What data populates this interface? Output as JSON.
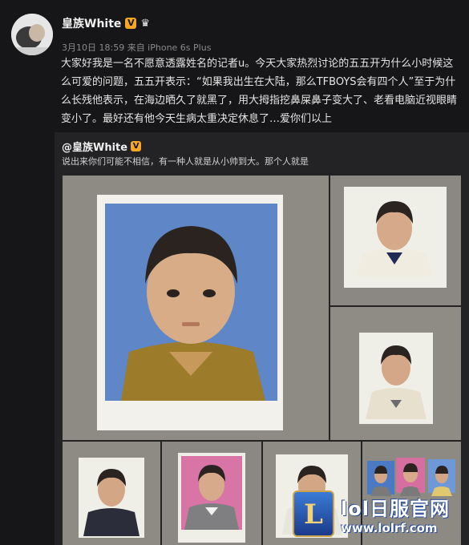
{
  "post": {
    "username": "皇族White",
    "verified_badge": "V",
    "crown_icon": "crown-icon",
    "meta": "3月10日 18:59 来自 iPhone 6s Plus",
    "text": "大家好我是一名不愿意透露姓名的记者u。今天大家热烈讨论的五五开为什么小时候这么可爱的问题，五五开表示：“如果我出生在大陆，那么TFBOYS会有四个人”至于为什么长残他表示，在海边晒久了就黑了，用大拇指挖鼻屎鼻子变大了、老看电脑近视眼睛变小了。最好还有他今天生病太重决定休息了…爱你们以上"
  },
  "repost": {
    "username": "@皇族White",
    "verified_badge": "V",
    "text": "说出来你们可能不相信，有一种人就是从小帅到大。那个人就是"
  },
  "watermark": {
    "logo_letter": "L",
    "title": "lol日服官网",
    "url": "www.lolrf.com"
  },
  "colors": {
    "background": "#161618",
    "repost_background": "#232325",
    "badge": "#f5a623"
  }
}
